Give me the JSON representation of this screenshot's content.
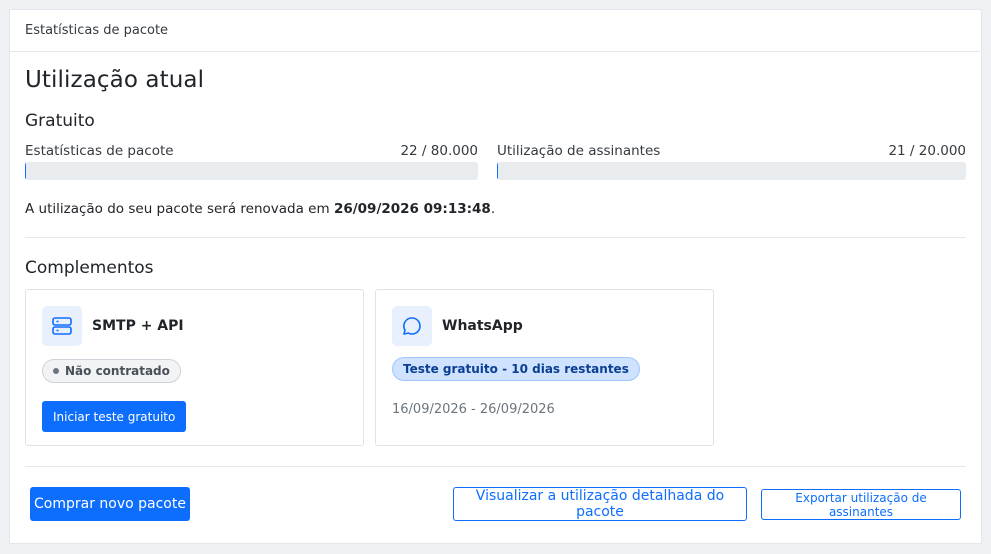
{
  "header": {
    "title": "Estatísticas de pacote"
  },
  "main": {
    "title": "Utilização atual",
    "plan_name": "Gratuito",
    "usage": [
      {
        "label": "Estatísticas de pacote",
        "value": "22 / 80.000",
        "fraction": 0.000275
      },
      {
        "label": "Utilização de assinantes",
        "value": "21 / 20.000",
        "fraction": 0.00105
      }
    ],
    "renew_text": "A utilização do seu pacote será renovada em ",
    "renew_date": "26/09/2026 09:13:48",
    "renew_suffix": "."
  },
  "addons": {
    "title": "Complementos",
    "items": [
      {
        "name": "SMTP + API",
        "icon": "server-icon",
        "status": "Não contratado",
        "action": "Iniciar teste gratuito"
      },
      {
        "name": "WhatsApp",
        "icon": "chat-bubble-icon",
        "status": "Teste gratuito - 10 dias restantes",
        "period": "16/09/2026 - 26/09/2026"
      }
    ]
  },
  "footer": {
    "buy_label": "Comprar novo pacote",
    "details_label": "Visualizar a utilização detalhada do pacote",
    "export_label": "Exportar utilização de assinantes"
  },
  "colors": {
    "primary": "#0d6efd",
    "badge_blue_bg": "#cfe2ff",
    "icon_bg": "#e8f0fe"
  }
}
